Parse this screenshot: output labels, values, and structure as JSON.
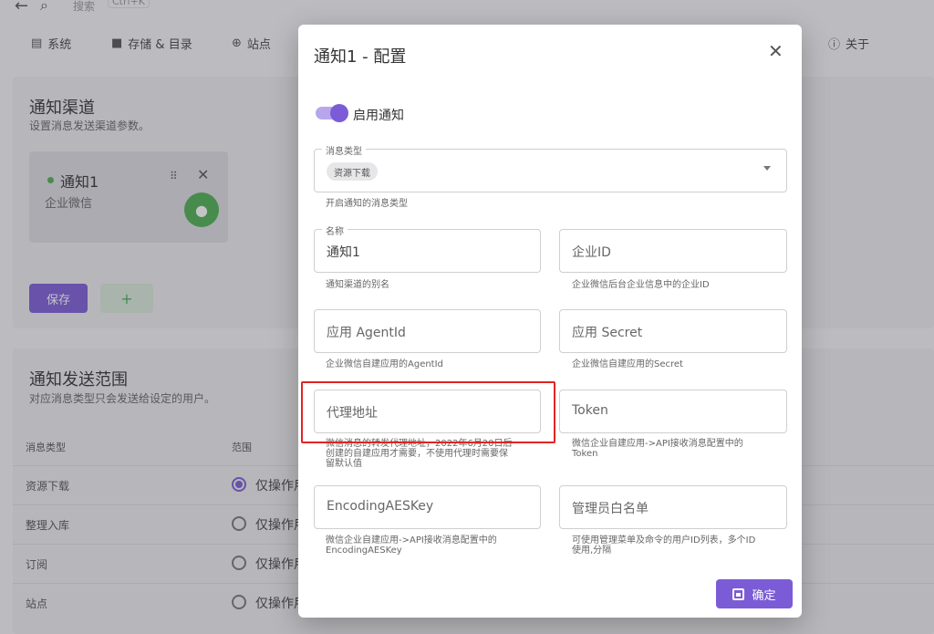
{
  "topbar": {
    "search_label": "搜索",
    "shortcut": "Ctrl+K"
  },
  "nav": {
    "items": [
      {
        "label": "系统",
        "icon": "server-icon"
      },
      {
        "label": "存储 & 目录",
        "icon": "folder-icon"
      },
      {
        "label": "站点",
        "icon": "globe-icon"
      },
      {
        "label": "关于",
        "icon": "info-icon"
      }
    ]
  },
  "channels_card": {
    "title": "通知渠道",
    "subtitle": "设置消息发送渠道参数。",
    "channel": {
      "name": "通知1",
      "type": "企业微信"
    },
    "save_label": "保存",
    "add_label": "+"
  },
  "scope_card": {
    "title": "通知发送范围",
    "subtitle": "对应消息类型只会发送给设定的用户。",
    "columns": [
      "消息类型",
      "范围"
    ],
    "rows": [
      {
        "type": "资源下载",
        "scope": "仅操作用",
        "selected": true
      },
      {
        "type": "整理入库",
        "scope": "仅操作用",
        "selected": false
      },
      {
        "type": "订阅",
        "scope": "仅操作用",
        "selected": false
      },
      {
        "type": "站点",
        "scope": "仅操作用",
        "selected": false
      }
    ]
  },
  "dialog": {
    "title": "通知1 - 配置",
    "enable_label": "启用通知",
    "enabled": true,
    "msg_type": {
      "legend": "消息类型",
      "chip": "资源下载",
      "hint": "开启通知的消息类型"
    },
    "name": {
      "legend": "名称",
      "value": "通知1",
      "hint": "通知渠道的别名"
    },
    "corp_id": {
      "placeholder": "企业ID",
      "hint": "企业微信后台企业信息中的企业ID"
    },
    "agent_id": {
      "placeholder": "应用 AgentId",
      "hint": "企业微信自建应用的AgentId"
    },
    "secret": {
      "placeholder": "应用 Secret",
      "hint": "企业微信自建应用的Secret"
    },
    "proxy": {
      "placeholder": "代理地址",
      "hint_line1": "微信消息的转发代理地址，2022年6月20日后",
      "hint_line2": "创建的自建应用才需要，不使用代理时需要保",
      "hint_line3": "留默认值"
    },
    "token": {
      "placeholder": "Token",
      "hint_line1": "微信企业自建应用->API接收消息配置中的",
      "hint_line2": "Token"
    },
    "aes_key": {
      "placeholder": "EncodingAESKey",
      "hint_line1": "微信企业自建应用->API接收消息配置中的",
      "hint_line2": "EncodingAESKey"
    },
    "admins": {
      "placeholder": "管理员白名单",
      "hint_line1": "可使用管理菜单及命令的用户ID列表，多个ID",
      "hint_line2": "使用,分隔"
    },
    "confirm_label": "确定"
  },
  "colors": {
    "accent": "#7b5cd6",
    "highlight": "#e02424",
    "success": "#4caf50"
  }
}
